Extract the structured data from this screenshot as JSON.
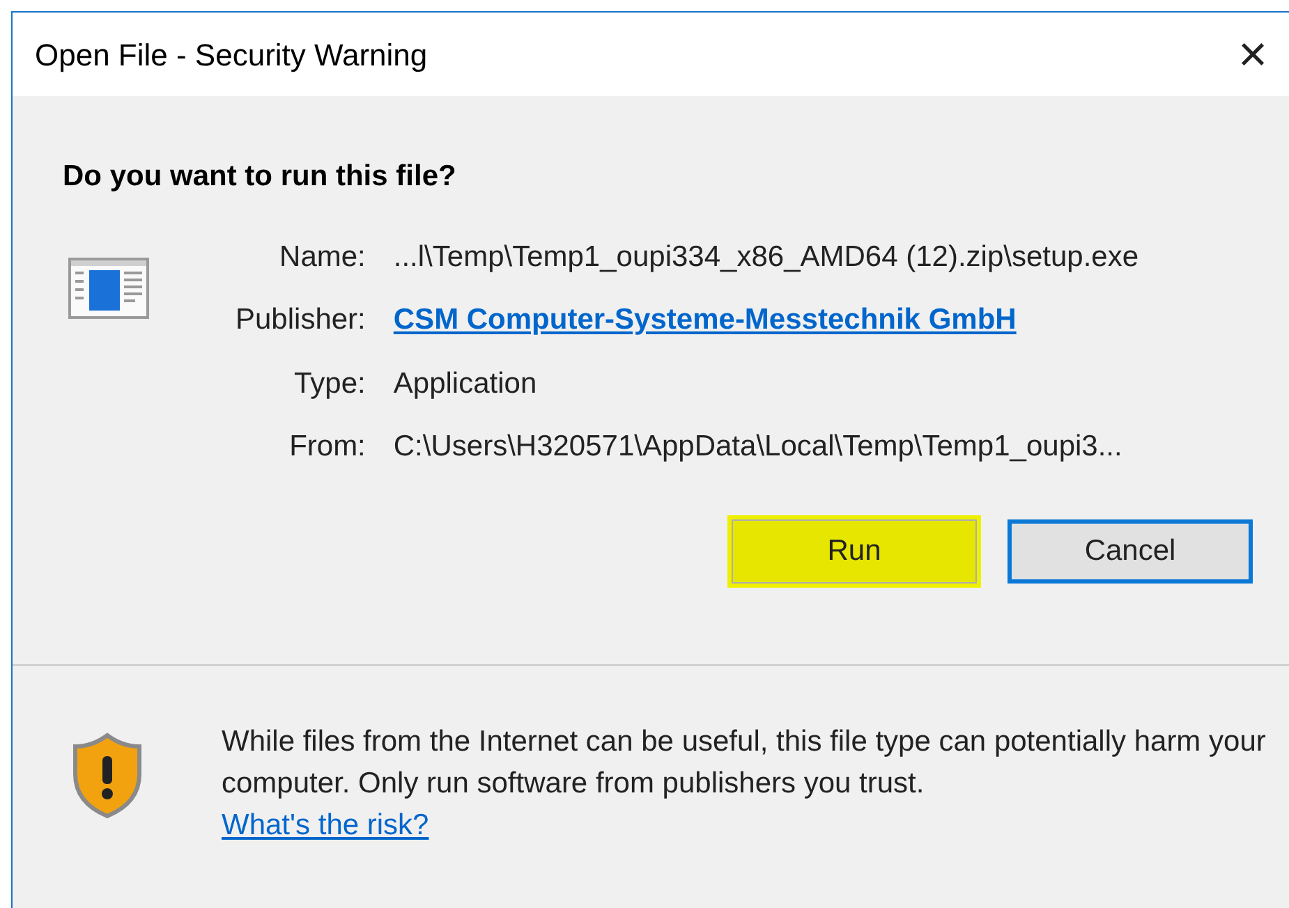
{
  "window": {
    "title": "Open File - Security Warning",
    "close": "×"
  },
  "question": "Do you want to run this file?",
  "fields": [
    {
      "label": "Name:",
      "value": "...l\\Temp\\Temp1_oupi334_x86_AMD64 (12).zip\\setup.exe",
      "kind": "text"
    },
    {
      "label": "Publisher:",
      "value": "CSM Computer-Systeme-Messtechnik GmbH",
      "kind": "link"
    },
    {
      "label": "Type:",
      "value": "Application",
      "kind": "text"
    },
    {
      "label": "From:",
      "value": "C:\\Users\\H320571\\AppData\\Local\\Temp\\Temp1_oupi3...",
      "kind": "text"
    }
  ],
  "buttons": [
    {
      "label": "Run",
      "highlighted": true,
      "focused": false
    },
    {
      "label": "Cancel",
      "highlighted": false,
      "focused": true
    }
  ],
  "warning": {
    "text": "While files from the Internet can be useful, this file type can potentially harm your computer. Only run software from publishers you trust.",
    "link": "What's the risk?"
  }
}
